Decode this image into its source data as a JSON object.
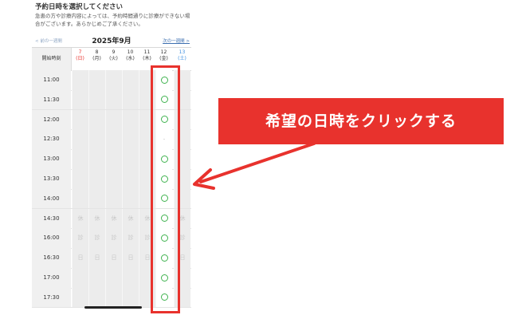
{
  "header": {
    "title": "予約日時を選択してください",
    "notice": "急患の方や診療内容によっては、予約時間通りに診療ができない場合がございます。あらかじめご了承ください。"
  },
  "week_nav": {
    "prev_label": "< 前の一週間",
    "month_label": "2025年9月",
    "next_label": "次の一週間 >"
  },
  "grid": {
    "start_time_label": "開始時刻",
    "days": [
      {
        "date": "7",
        "weekday": "(日)",
        "color": "#e8322d"
      },
      {
        "date": "8",
        "weekday": "(月)",
        "color": "#333333"
      },
      {
        "date": "9",
        "weekday": "(火)",
        "color": "#333333"
      },
      {
        "date": "10",
        "weekday": "(水)",
        "color": "#333333"
      },
      {
        "date": "11",
        "weekday": "(木)",
        "color": "#333333"
      },
      {
        "date": "12",
        "weekday": "(金)",
        "color": "#333333"
      },
      {
        "date": "13",
        "weekday": "(土)",
        "color": "#3d8fe0"
      }
    ],
    "times": [
      "11:00",
      "11:30",
      "12:00",
      "12:30",
      "13:00",
      "13:30",
      "14:00",
      "14:30",
      "16:00",
      "16:30",
      "17:00",
      "17:30"
    ],
    "column12_status": [
      "○",
      "○",
      "○",
      "-",
      "○",
      "○",
      "○",
      "○",
      "○",
      "○",
      "○",
      "○"
    ],
    "closed_marks": {
      "14:30": "休",
      "16:00": "診",
      "16:30": "日"
    }
  },
  "callout": {
    "text": "希望の日時をクリックする",
    "color": "#e8322d"
  },
  "colors": {
    "available": "#3fb34f",
    "highlight": "#e8322d"
  }
}
